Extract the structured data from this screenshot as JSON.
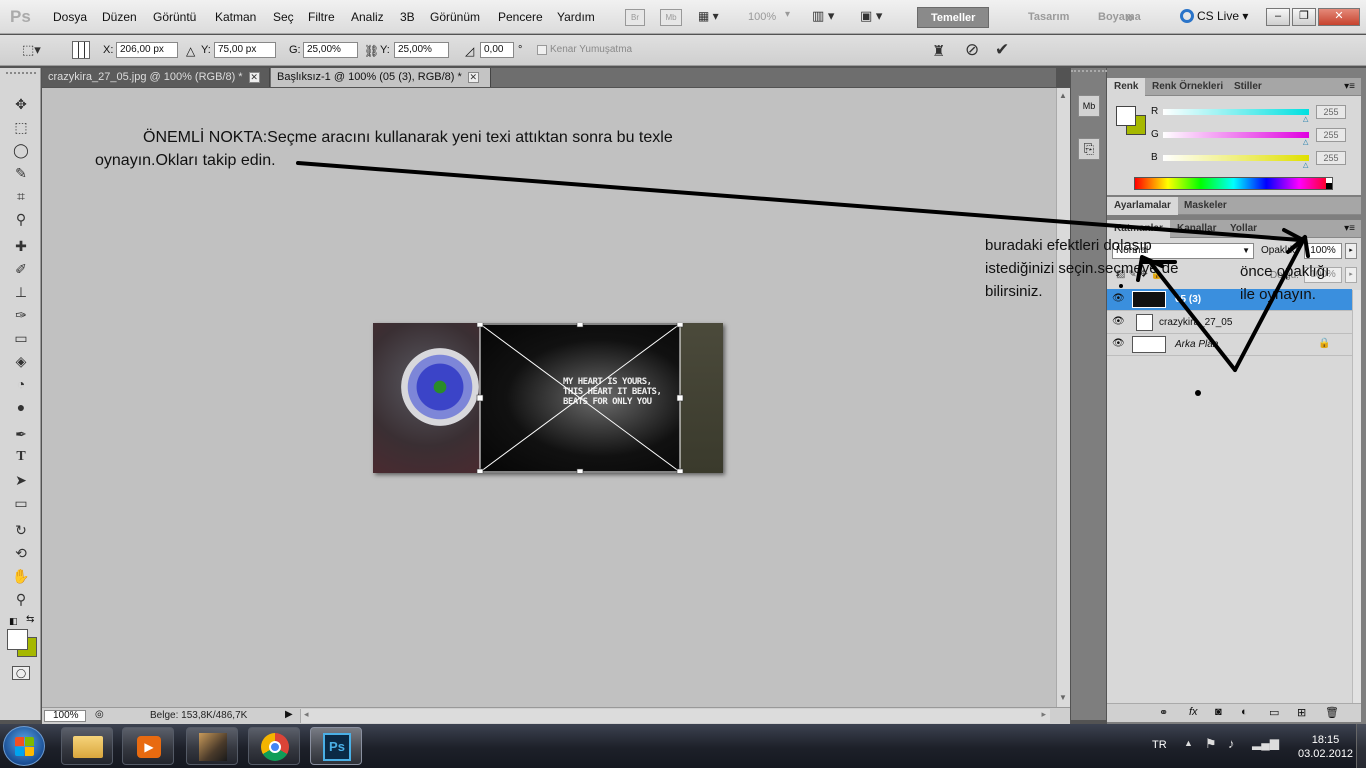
{
  "app": {
    "logo": "Ps"
  },
  "menu": [
    "Dosya",
    "Düzen",
    "Görüntü",
    "Katman",
    "Seç",
    "Filtre",
    "Analiz",
    "3B",
    "Görünüm",
    "Pencere",
    "Yardım"
  ],
  "appbar": {
    "bridge": "Br",
    "minibridge": "Mb",
    "zoom": "100%"
  },
  "workspaces": {
    "active": "Temeller",
    "design": "Tasarım",
    "painting": "Boyama",
    "more": "»"
  },
  "cslive": "CS Live",
  "window_controls": {
    "min": "–",
    "max": "❐",
    "close": "✕"
  },
  "options": {
    "x_label": "X:",
    "x_value": "206,00 px",
    "y_label": "Y:",
    "y_value": "75,00 px",
    "w_label": "G:",
    "w_value": "25,00%",
    "h_label": "Y:",
    "h_value": "25,00%",
    "angle_value": "0,00",
    "degree": "°",
    "antialias_label": "Kenar Yumuşatma"
  },
  "doc_tabs": [
    {
      "title": "crazykira_27_05.jpg @ 100% (RGB/8) *"
    },
    {
      "title": "Başlıksız-1 @ 100% (05 (3), RGB/8) *"
    }
  ],
  "tab_close": "✕",
  "annotations": {
    "main_line1": "ÖNEMLİ NOKTA:Seçme aracını kullanarak yeni texi attıktan sonra bu texle",
    "main_line2": "oynayın.Okları takip edin.",
    "effects_line1": "buradaki efektleri dolaşıp",
    "effects_line2": "istediğinizi seçin.seçmeye de",
    "effects_line3": "bilirsiniz.",
    "opacity_line1": "önce opaklığı",
    "opacity_line2": "ile oynayın."
  },
  "image_text": {
    "line1": "MY HEART IS YOURS,",
    "line2": "THIS HEART IT BEATS,",
    "line3": "BEATS FOR ONLY YOU"
  },
  "status": {
    "zoom": "100%",
    "doc": "Belge: 153,8K/486,7K"
  },
  "color_panel": {
    "tabs": [
      "Renk",
      "Renk Örnekleri",
      "Stiller"
    ],
    "channels": [
      {
        "label": "R",
        "value": "255",
        "color": "#00e0e0"
      },
      {
        "label": "G",
        "value": "255",
        "color": "#e000e0"
      },
      {
        "label": "B",
        "value": "255",
        "color": "#e0e000"
      }
    ],
    "fg_color": "#ffffff",
    "bg_color": "#a6b800"
  },
  "adjust_panel": {
    "tabs": [
      "Ayarlamalar",
      "Maskeler"
    ]
  },
  "layers_panel": {
    "tabs": [
      "Katmanlar",
      "Kanallar",
      "Yollar"
    ],
    "blend_mode": "Normal",
    "opacity_label": "Opaklık:",
    "opacity_value": "100%",
    "fill_label": "Dolgu:",
    "fill_value": "100%",
    "layers": [
      {
        "name": "05 (3)",
        "selected": true
      },
      {
        "name": "crazykira_27_05",
        "selected": false
      },
      {
        "name": "Arka Plan",
        "selected": false,
        "locked": true
      }
    ],
    "footer_icons": [
      "link-icon",
      "fx-icon",
      "mask-icon",
      "adjustment-icon",
      "group-icon",
      "new-layer-icon",
      "trash-icon"
    ]
  },
  "taskbar": {
    "lang": "TR",
    "time": "18:15",
    "date": "03.02.2012",
    "apps": [
      "explorer",
      "media-player",
      "game",
      "chrome",
      "photoshop"
    ],
    "photoshop_label": "Ps"
  },
  "colors": {
    "accent": "#3a8fde",
    "arrow": "#000000"
  }
}
